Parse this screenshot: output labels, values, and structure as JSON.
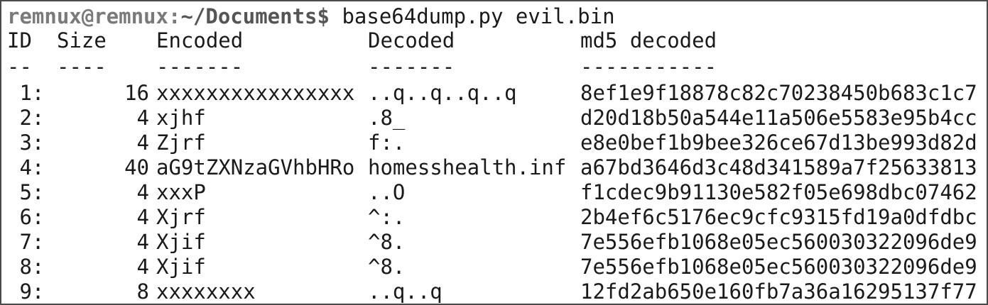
{
  "prompt": {
    "user_host": "remnux@remnux",
    "separator": ":",
    "path": "~/Documents",
    "symbol": "$",
    "command": " base64dump.py evil.bin"
  },
  "table": {
    "headers": {
      "id": "ID",
      "size": "Size",
      "encoded": "Encoded",
      "decoded": "Decoded",
      "md5": "md5 decoded"
    },
    "dashes": {
      "id": "--",
      "size": "----",
      "encoded": "-------",
      "decoded": "-------",
      "md5": "-----------"
    },
    "rows": [
      {
        "id": " 1:",
        "size": "16",
        "encoded": "xxxxxxxxxxxxxxxx",
        "decoded": "..q..q..q..q",
        "md5": "8ef1e9f18878c82c70238450b683c1c7"
      },
      {
        "id": " 2:",
        "size": "4",
        "encoded": "xjhf",
        "decoded": ".8_",
        "md5": "d20d18b50a544e11a506e5583e95b4cc"
      },
      {
        "id": " 3:",
        "size": "4",
        "encoded": "Zjrf",
        "decoded": "f:.",
        "md5": "e8e0bef1b9bee326ce67d13be993d82d"
      },
      {
        "id": " 4:",
        "size": "40",
        "encoded": "aG9tZXNzaGVhbHRo",
        "decoded": "homesshealth.inf",
        "md5": "a67bd3646d3c48d341589a7f25633813"
      },
      {
        "id": " 5:",
        "size": "4",
        "encoded": "xxxP",
        "decoded": "..O",
        "md5": "f1cdec9b91130e582f05e698dbc07462"
      },
      {
        "id": " 6:",
        "size": "4",
        "encoded": "Xjrf",
        "decoded": "^:.",
        "md5": "2b4ef6c5176ec9cfc9315fd19a0dfdbc"
      },
      {
        "id": " 7:",
        "size": "4",
        "encoded": "Xjif",
        "decoded": "^8.",
        "md5": "7e556efb1068e05ec560030322096de9"
      },
      {
        "id": " 8:",
        "size": "4",
        "encoded": "Xjif",
        "decoded": "^8.",
        "md5": "7e556efb1068e05ec560030322096de9"
      },
      {
        "id": " 9:",
        "size": "8",
        "encoded": "xxxxxxxx",
        "decoded": "..q..q",
        "md5": "12fd2ab650e160fb7a36a16295137f77"
      }
    ]
  }
}
